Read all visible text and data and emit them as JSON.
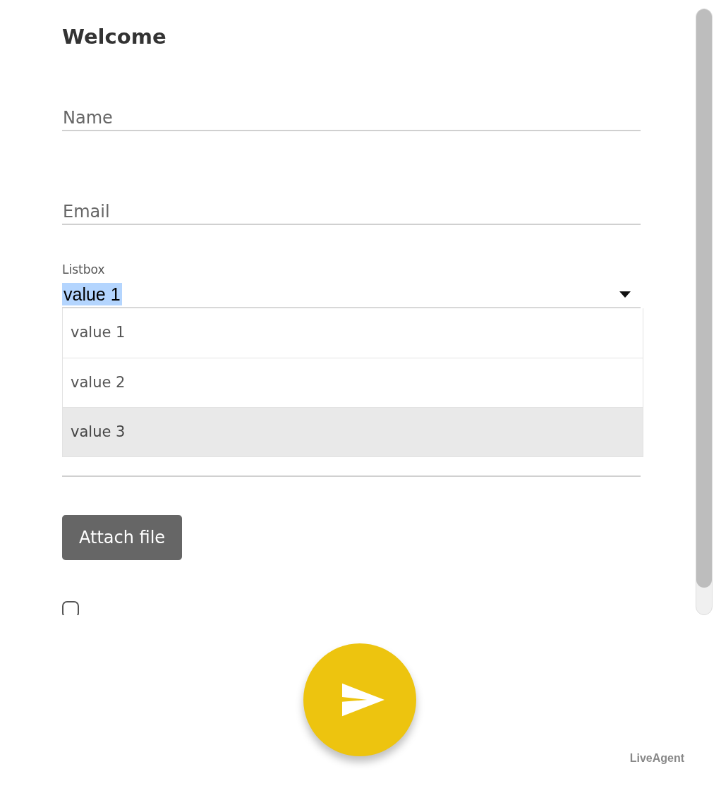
{
  "title": "Welcome",
  "fields": [
    {
      "placeholder": "Name"
    },
    {
      "placeholder": "Email"
    }
  ],
  "listbox": {
    "label": "Listbox",
    "value": "value 1",
    "expanded": true,
    "options": [
      {
        "label": "value 1",
        "hovered": false
      },
      {
        "label": "value 2",
        "hovered": false
      },
      {
        "label": "value 3",
        "hovered": true
      }
    ]
  },
  "attach_button": "Attach file",
  "remember_checkbox": {
    "checked": false
  },
  "send_button": {
    "kind": "send"
  },
  "brand": "LiveAgent"
}
